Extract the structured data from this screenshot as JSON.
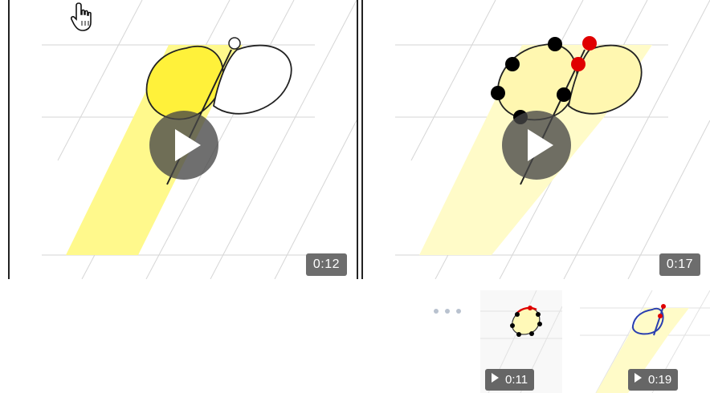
{
  "videos": [
    {
      "duration": "0:12"
    },
    {
      "duration": "0:17"
    }
  ],
  "thumbnails": [
    {
      "duration": "0:11"
    },
    {
      "duration": "0:19"
    }
  ],
  "colors": {
    "guide_fill": "#fff98c",
    "guide_fill_light": "#fffbc8",
    "stroke": "#222222",
    "red_point": "#e00000",
    "black_point": "#000000",
    "overlay": "#464646",
    "badge": "#6d6d6d",
    "blue_stroke": "#2a3fb0"
  },
  "icons": [
    "hand-pointer-icon",
    "play-icon",
    "more-dots-icon"
  ]
}
